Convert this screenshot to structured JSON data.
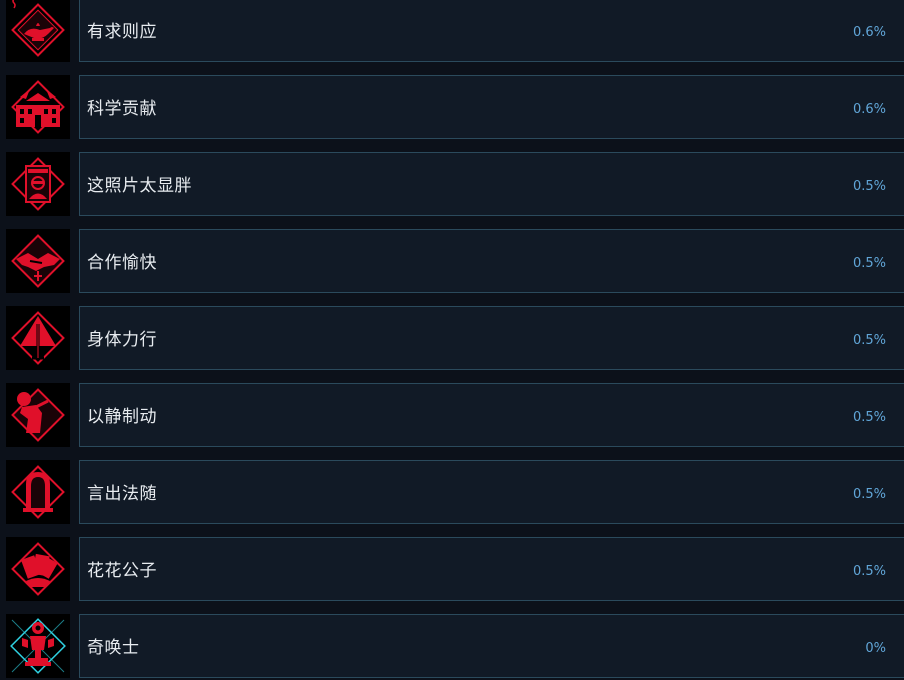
{
  "achievements": [
    {
      "name": "有求则应",
      "percent": "0.6%",
      "icon": "genie-lamp-icon"
    },
    {
      "name": "科学贡献",
      "percent": "0.6%",
      "icon": "building-icon"
    },
    {
      "name": "这照片太显胖",
      "percent": "0.5%",
      "icon": "wanted-poster-icon"
    },
    {
      "name": "合作愉快",
      "percent": "0.5%",
      "icon": "handshake-icon"
    },
    {
      "name": "身体力行",
      "percent": "0.5%",
      "icon": "pyramid-icon"
    },
    {
      "name": "以静制动",
      "percent": "0.5%",
      "icon": "figure-icon"
    },
    {
      "name": "言出法随",
      "percent": "0.5%",
      "icon": "arch-door-icon"
    },
    {
      "name": "花花公子",
      "percent": "0.5%",
      "icon": "playing-cards-icon"
    },
    {
      "name": "奇唤士",
      "percent": "0%",
      "icon": "trophy-icon"
    }
  ],
  "colors": {
    "icon_red": "#e0102a",
    "icon_bg": "#000000",
    "panel_bg": "#111a26",
    "panel_border": "#2b4a5c",
    "percent_text": "#61a6d8",
    "name_text": "#e8ecf0",
    "accent_cyan": "#2fd0e0"
  }
}
